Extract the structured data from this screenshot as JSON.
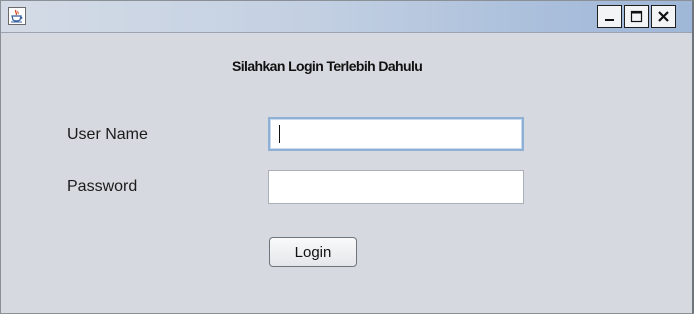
{
  "window": {
    "title": "",
    "icons": {
      "app": "java-cup-icon",
      "minimize": "minimize-icon",
      "maximize": "maximize-icon",
      "close": "close-icon"
    }
  },
  "form": {
    "heading": "Silahkan Login Terlebih Dahulu",
    "username": {
      "label": "User Name",
      "value": ""
    },
    "password": {
      "label": "Password",
      "value": ""
    },
    "login_button": "Login"
  },
  "colors": {
    "client_bg": "#d6d9df",
    "titlebar_accent": "#a9bedb",
    "focus_border": "#8fb0d6"
  }
}
